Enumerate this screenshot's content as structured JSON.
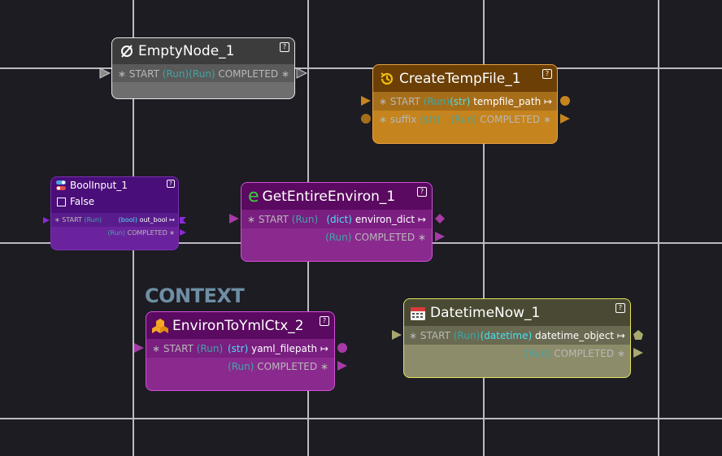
{
  "context_label": "CONTEXT",
  "nodes": {
    "empty_node": {
      "title": "EmptyNode_1",
      "icon": "empty-set-icon",
      "help": "?",
      "in_star": "∗",
      "in_label": "START",
      "in_type": "(Run)",
      "out_type": "(Run)",
      "out_label": "COMPLETED",
      "out_star": "∗",
      "color": "#8c8c8c"
    },
    "create_temp_file": {
      "title": "CreateTempFile_1",
      "icon": "history-icon",
      "help": "?",
      "row1_in_star": "∗",
      "row1_in_label": "START",
      "row1_in_type": "(Run)",
      "row1_out_type": "(str)",
      "row1_out_label": "tempfile_path ↦",
      "row2_in_star": "∗",
      "row2_in_label": "suffix",
      "row2_in_type": "(str)",
      "row2_out_type": "(Run)",
      "row2_out_label": "COMPLETED",
      "row2_out_star": "∗",
      "color": "#c5841d"
    },
    "bool_input": {
      "title": "BoolInput_1",
      "icon": "toggle-icon",
      "help": "?",
      "checkbox_label": "False",
      "checked": false,
      "in_star": "∗",
      "in_label": "START",
      "in_type": "(Run)",
      "out_type": "(bool)",
      "out_label": "out_bool ↦",
      "out2_type": "(Run)",
      "out2_label": "COMPLETED",
      "out2_star": "∗",
      "color": "#6a239c"
    },
    "get_entire_environ": {
      "title": "GetEntireEnviron_1",
      "icon_letter": "e",
      "help": "?",
      "in_star": "∗",
      "in_label": "START",
      "in_type": "(Run)",
      "out_type": "(dict)",
      "out_label": "environ_dict ↦",
      "out2_type": "(Run)",
      "out2_label": "COMPLETED",
      "out2_star": "∗",
      "color": "#8a2a8e"
    },
    "environ_to_yml": {
      "title": "EnvironToYmlCtx_2",
      "icon": "boxes-icon",
      "help": "?",
      "in_star": "∗",
      "in_label": "START",
      "in_type": "(Run)",
      "out_type": "(str)",
      "out_label": "yaml_filepath ↦",
      "out2_type": "(Run)",
      "out2_label": "COMPLETED",
      "out2_star": "∗",
      "color": "#8a2a8e"
    },
    "datetime_now": {
      "title": "DatetimeNow_1",
      "icon": "calendar-icon",
      "help": "?",
      "in_star": "∗",
      "in_label": "START",
      "in_type": "(Run)",
      "out_type": "(datetime)",
      "out_label": "datetime_object ↦",
      "out2_type": "(Run)",
      "out2_label": "COMPLETED",
      "out2_star": "∗",
      "color": "#8c8c6a"
    }
  }
}
